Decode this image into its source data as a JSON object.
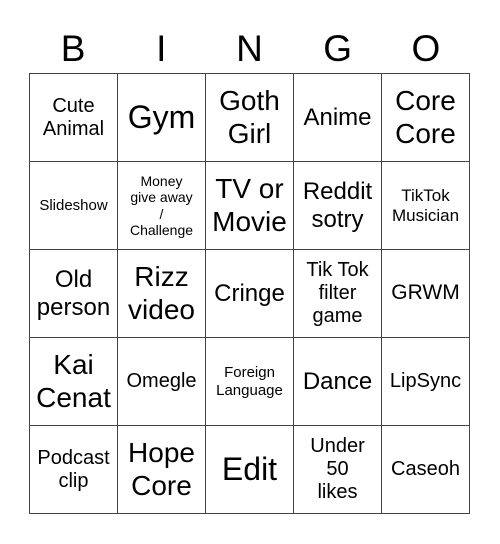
{
  "title_letters": [
    "B",
    "I",
    "N",
    "G",
    "O"
  ],
  "board": {
    "rows": [
      [
        {
          "text": "Cute\nAnimal"
        },
        {
          "text": "Gym"
        },
        {
          "text": "Goth\nGirl"
        },
        {
          "text": "Anime"
        },
        {
          "text": "Core\nCore"
        }
      ],
      [
        {
          "text": "Slideshow"
        },
        {
          "text": "Money\ngive away\n/\nChallenge"
        },
        {
          "text": "TV or\nMovie"
        },
        {
          "text": "Reddit\nsotry"
        },
        {
          "text": "TikTok\nMusician"
        }
      ],
      [
        {
          "text": "Old\nperson"
        },
        {
          "text": "Rizz\nvideo"
        },
        {
          "text": "Cringe"
        },
        {
          "text": "Tik Tok\nfilter\ngame"
        },
        {
          "text": "GRWM"
        }
      ],
      [
        {
          "text": "Kai\nCenat"
        },
        {
          "text": "Omegle"
        },
        {
          "text": "Foreign\nLanguage"
        },
        {
          "text": "Dance"
        },
        {
          "text": "LipSync"
        }
      ],
      [
        {
          "text": "Podcast\nclip"
        },
        {
          "text": "Hope\nCore"
        },
        {
          "text": "Edit"
        },
        {
          "text": "Under\n50\nlikes"
        },
        {
          "text": "Caseoh"
        }
      ]
    ]
  }
}
